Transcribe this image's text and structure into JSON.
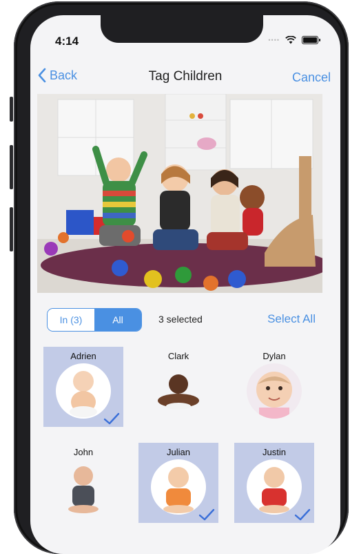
{
  "status": {
    "time": "4:14",
    "wifi_icon": "wifi-icon",
    "battery_icon": "battery-icon"
  },
  "nav": {
    "back_label": "Back",
    "title": "Tag Children",
    "cancel_label": "Cancel"
  },
  "photo": {
    "description_icon": "group-photo"
  },
  "filter": {
    "in_label": "In (3)",
    "all_label": "All",
    "active": "All"
  },
  "selection": {
    "summary": "3 selected",
    "select_all_label": "Select All"
  },
  "children": [
    {
      "name": "Adrien",
      "selected": true
    },
    {
      "name": "Clark",
      "selected": false
    },
    {
      "name": "Dylan",
      "selected": false
    },
    {
      "name": "John",
      "selected": false
    },
    {
      "name": "Julian",
      "selected": true
    },
    {
      "name": "Justin",
      "selected": true
    }
  ],
  "colors": {
    "accent": "#4a90e2",
    "selected_bg": "#c2cbe7",
    "frame": "#1f1f22"
  }
}
